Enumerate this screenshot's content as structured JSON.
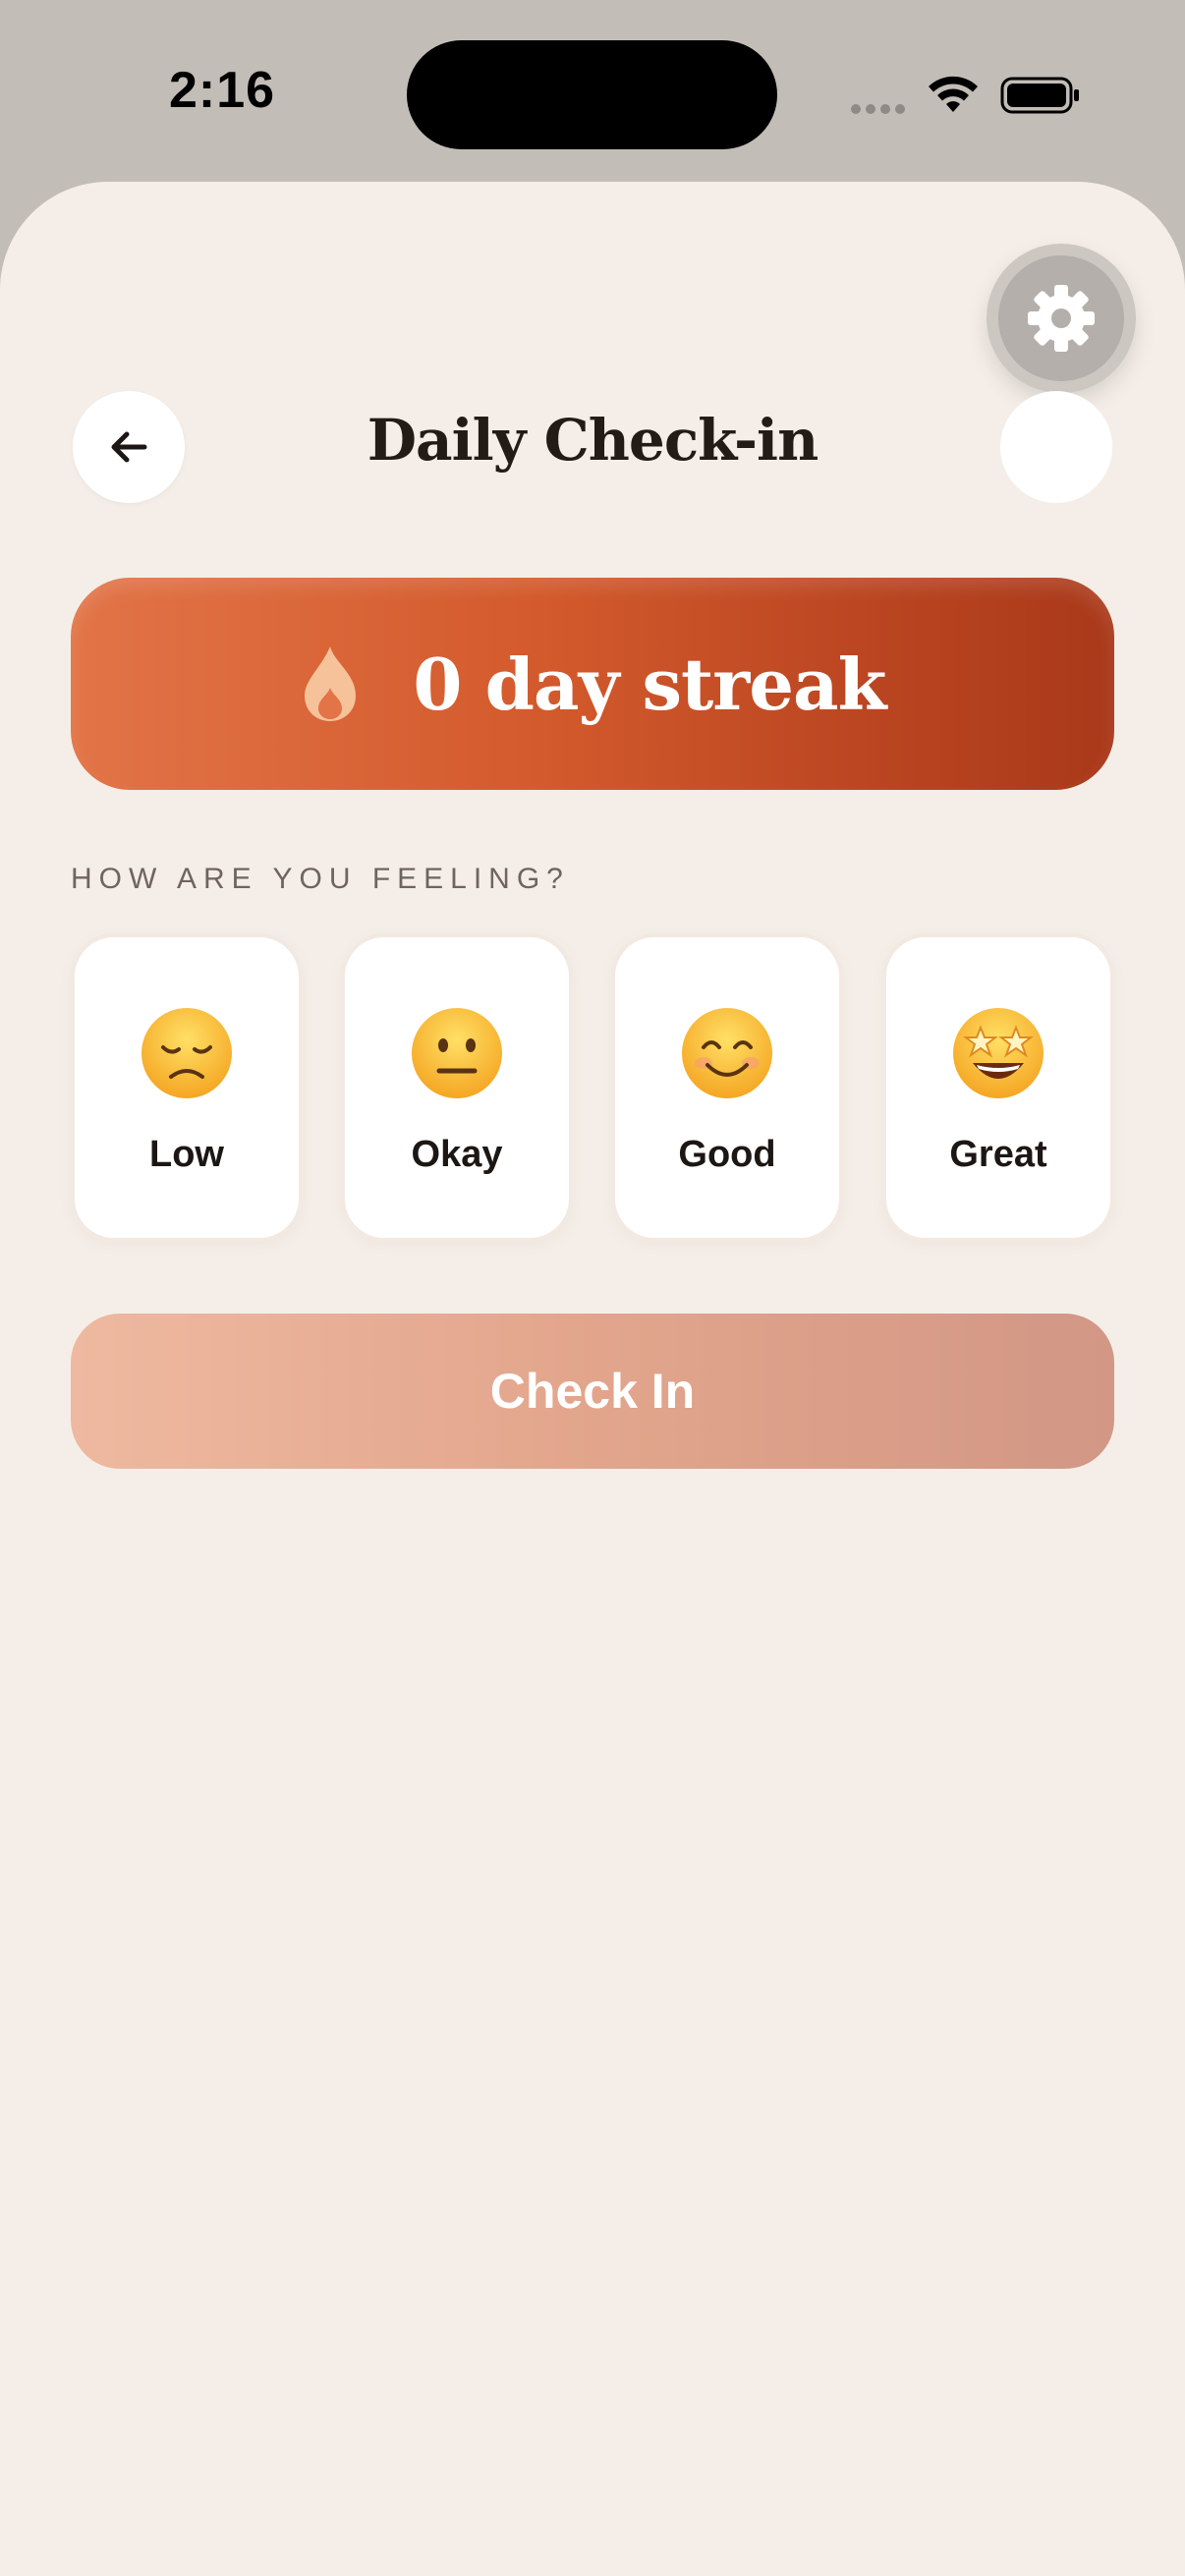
{
  "status_bar": {
    "time": "2:16"
  },
  "header": {
    "title": "Daily Check-in",
    "back_icon": "arrow-left-icon",
    "settings_icon": "gear-icon"
  },
  "streak": {
    "icon": "flame-icon",
    "text": "0 day streak"
  },
  "mood_section": {
    "label": "HOW ARE YOU FEELING?",
    "options": [
      {
        "label": "Low",
        "icon": "disappointed-face-icon"
      },
      {
        "label": "Okay",
        "icon": "neutral-face-icon"
      },
      {
        "label": "Good",
        "icon": "smiling-face-icon"
      },
      {
        "label": "Great",
        "icon": "star-struck-face-icon"
      }
    ]
  },
  "check_in_button": {
    "label": "Check In"
  },
  "colors": {
    "background": "#f5eee8",
    "streak_start": "#e27447",
    "streak_end": "#a9391a",
    "button_disabled": "#e2a58c",
    "title_text": "#221b16"
  }
}
